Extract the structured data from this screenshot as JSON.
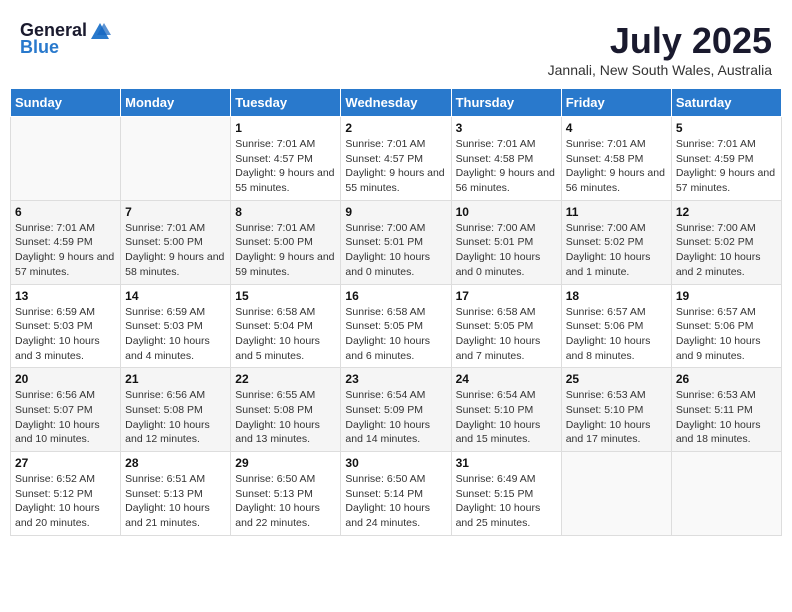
{
  "logo": {
    "general": "General",
    "blue": "Blue"
  },
  "title": {
    "month_year": "July 2025",
    "location": "Jannali, New South Wales, Australia"
  },
  "weekdays": [
    "Sunday",
    "Monday",
    "Tuesday",
    "Wednesday",
    "Thursday",
    "Friday",
    "Saturday"
  ],
  "weeks": [
    [
      {
        "day": "",
        "content": ""
      },
      {
        "day": "",
        "content": ""
      },
      {
        "day": "1",
        "content": "Sunrise: 7:01 AM\nSunset: 4:57 PM\nDaylight: 9 hours and 55 minutes."
      },
      {
        "day": "2",
        "content": "Sunrise: 7:01 AM\nSunset: 4:57 PM\nDaylight: 9 hours and 55 minutes."
      },
      {
        "day": "3",
        "content": "Sunrise: 7:01 AM\nSunset: 4:58 PM\nDaylight: 9 hours and 56 minutes."
      },
      {
        "day": "4",
        "content": "Sunrise: 7:01 AM\nSunset: 4:58 PM\nDaylight: 9 hours and 56 minutes."
      },
      {
        "day": "5",
        "content": "Sunrise: 7:01 AM\nSunset: 4:59 PM\nDaylight: 9 hours and 57 minutes."
      }
    ],
    [
      {
        "day": "6",
        "content": "Sunrise: 7:01 AM\nSunset: 4:59 PM\nDaylight: 9 hours and 57 minutes."
      },
      {
        "day": "7",
        "content": "Sunrise: 7:01 AM\nSunset: 5:00 PM\nDaylight: 9 hours and 58 minutes."
      },
      {
        "day": "8",
        "content": "Sunrise: 7:01 AM\nSunset: 5:00 PM\nDaylight: 9 hours and 59 minutes."
      },
      {
        "day": "9",
        "content": "Sunrise: 7:00 AM\nSunset: 5:01 PM\nDaylight: 10 hours and 0 minutes."
      },
      {
        "day": "10",
        "content": "Sunrise: 7:00 AM\nSunset: 5:01 PM\nDaylight: 10 hours and 0 minutes."
      },
      {
        "day": "11",
        "content": "Sunrise: 7:00 AM\nSunset: 5:02 PM\nDaylight: 10 hours and 1 minute."
      },
      {
        "day": "12",
        "content": "Sunrise: 7:00 AM\nSunset: 5:02 PM\nDaylight: 10 hours and 2 minutes."
      }
    ],
    [
      {
        "day": "13",
        "content": "Sunrise: 6:59 AM\nSunset: 5:03 PM\nDaylight: 10 hours and 3 minutes."
      },
      {
        "day": "14",
        "content": "Sunrise: 6:59 AM\nSunset: 5:03 PM\nDaylight: 10 hours and 4 minutes."
      },
      {
        "day": "15",
        "content": "Sunrise: 6:58 AM\nSunset: 5:04 PM\nDaylight: 10 hours and 5 minutes."
      },
      {
        "day": "16",
        "content": "Sunrise: 6:58 AM\nSunset: 5:05 PM\nDaylight: 10 hours and 6 minutes."
      },
      {
        "day": "17",
        "content": "Sunrise: 6:58 AM\nSunset: 5:05 PM\nDaylight: 10 hours and 7 minutes."
      },
      {
        "day": "18",
        "content": "Sunrise: 6:57 AM\nSunset: 5:06 PM\nDaylight: 10 hours and 8 minutes."
      },
      {
        "day": "19",
        "content": "Sunrise: 6:57 AM\nSunset: 5:06 PM\nDaylight: 10 hours and 9 minutes."
      }
    ],
    [
      {
        "day": "20",
        "content": "Sunrise: 6:56 AM\nSunset: 5:07 PM\nDaylight: 10 hours and 10 minutes."
      },
      {
        "day": "21",
        "content": "Sunrise: 6:56 AM\nSunset: 5:08 PM\nDaylight: 10 hours and 12 minutes."
      },
      {
        "day": "22",
        "content": "Sunrise: 6:55 AM\nSunset: 5:08 PM\nDaylight: 10 hours and 13 minutes."
      },
      {
        "day": "23",
        "content": "Sunrise: 6:54 AM\nSunset: 5:09 PM\nDaylight: 10 hours and 14 minutes."
      },
      {
        "day": "24",
        "content": "Sunrise: 6:54 AM\nSunset: 5:10 PM\nDaylight: 10 hours and 15 minutes."
      },
      {
        "day": "25",
        "content": "Sunrise: 6:53 AM\nSunset: 5:10 PM\nDaylight: 10 hours and 17 minutes."
      },
      {
        "day": "26",
        "content": "Sunrise: 6:53 AM\nSunset: 5:11 PM\nDaylight: 10 hours and 18 minutes."
      }
    ],
    [
      {
        "day": "27",
        "content": "Sunrise: 6:52 AM\nSunset: 5:12 PM\nDaylight: 10 hours and 20 minutes."
      },
      {
        "day": "28",
        "content": "Sunrise: 6:51 AM\nSunset: 5:13 PM\nDaylight: 10 hours and 21 minutes."
      },
      {
        "day": "29",
        "content": "Sunrise: 6:50 AM\nSunset: 5:13 PM\nDaylight: 10 hours and 22 minutes."
      },
      {
        "day": "30",
        "content": "Sunrise: 6:50 AM\nSunset: 5:14 PM\nDaylight: 10 hours and 24 minutes."
      },
      {
        "day": "31",
        "content": "Sunrise: 6:49 AM\nSunset: 5:15 PM\nDaylight: 10 hours and 25 minutes."
      },
      {
        "day": "",
        "content": ""
      },
      {
        "day": "",
        "content": ""
      }
    ]
  ]
}
